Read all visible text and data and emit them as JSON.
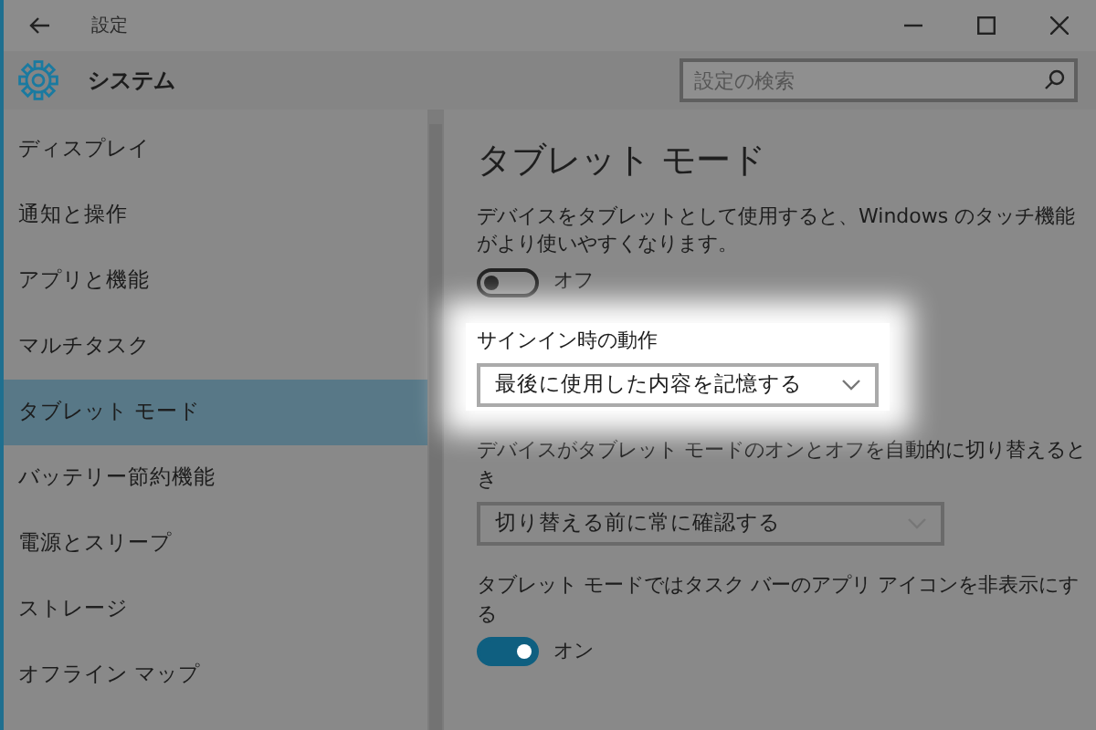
{
  "window": {
    "title": "設定"
  },
  "header": {
    "title": "システム",
    "search": {
      "placeholder": "設定の検索"
    }
  },
  "sidebar": {
    "items": [
      {
        "label": "ディスプレイ",
        "selected": false
      },
      {
        "label": "通知と操作",
        "selected": false
      },
      {
        "label": "アプリと機能",
        "selected": false
      },
      {
        "label": "マルチタスク",
        "selected": false
      },
      {
        "label": "タブレット モード",
        "selected": true
      },
      {
        "label": "バッテリー節約機能",
        "selected": false
      },
      {
        "label": "電源とスリープ",
        "selected": false
      },
      {
        "label": "ストレージ",
        "selected": false
      },
      {
        "label": "オフライン マップ",
        "selected": false
      }
    ]
  },
  "page": {
    "title": "タブレット モード",
    "settings": [
      {
        "kind": "toggle",
        "highlighted": false,
        "description": "デバイスをタブレットとして使用すると、Windows のタッチ機能がより使いやすくなります。",
        "on": false,
        "state_label": "オフ"
      },
      {
        "kind": "dropdown",
        "highlighted": true,
        "label": "サインイン時の動作",
        "value": "最後に使用した内容を記憶する"
      },
      {
        "kind": "dropdown",
        "highlighted": false,
        "label": "デバイスがタブレット モードのオンとオフを自動的に切り替えるとき",
        "value": "切り替える前に常に確認する"
      },
      {
        "kind": "toggle",
        "highlighted": false,
        "description": "タブレット モードではタスク バーのアプリ アイコンを非表示にする",
        "on": true,
        "state_label": "オン"
      }
    ]
  }
}
